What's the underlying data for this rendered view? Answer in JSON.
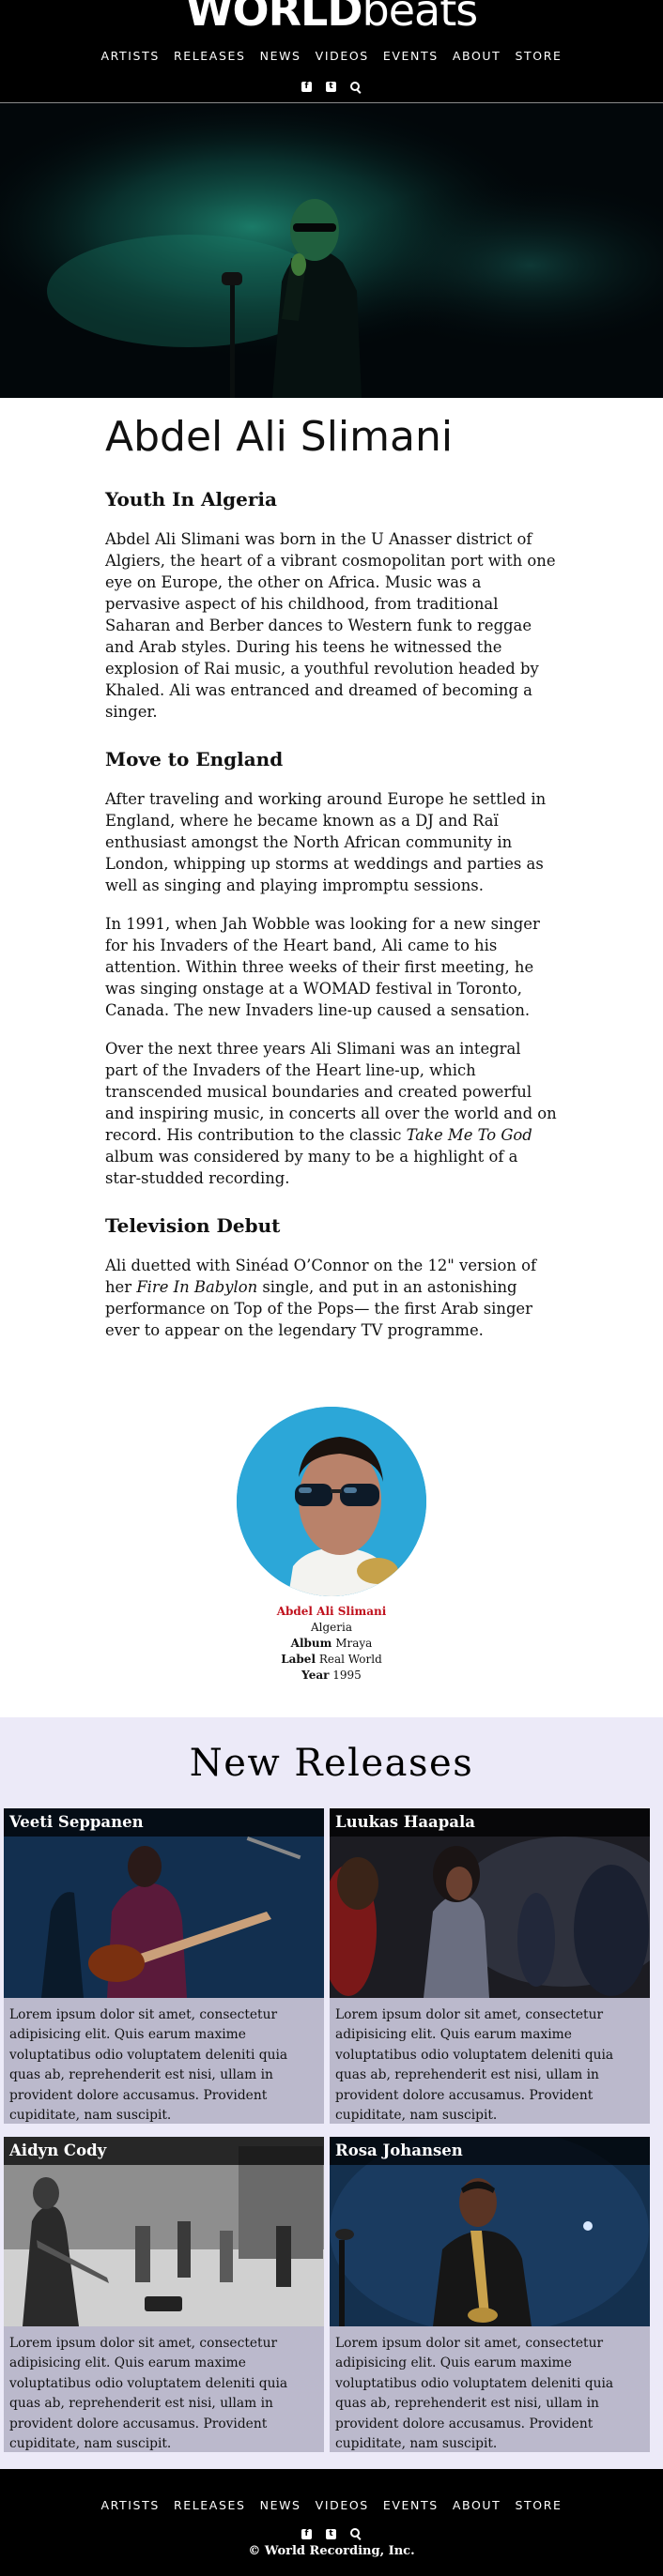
{
  "brand": {
    "bold": "WORLD",
    "light": "beats"
  },
  "nav": [
    "ARTISTS",
    "RELEASES",
    "NEWS",
    "VIDEOS",
    "EVENTS",
    "ABOUT",
    "STORE"
  ],
  "icons": [
    "facebook-icon",
    "twitter-icon",
    "search-icon"
  ],
  "artist": {
    "name": "Abdel Ali Slimani",
    "sections": [
      {
        "heading": "Youth In Algeria",
        "paragraphs": [
          [
            "Abdel Ali Slimani was born in the U Anasser district of Algiers, the heart of a vibrant cosmopolitan port with one eye on Europe, the other on Africa. Music was a pervasive aspect of his childhood, from traditional Saharan and Berber dances to Western funk to reggae and Arab styles. During his teens he witnessed the explosion of Rai music, a youthful revolution headed by Khaled. Ali was entranced and dreamed of becoming a singer.",
            "",
            ""
          ]
        ]
      },
      {
        "heading": "Move to England",
        "paragraphs": [
          [
            "After traveling and working around Europe he settled in England, where he became known as a DJ and Raï enthusiast amongst the North African community in London, whipping up storms at weddings and parties as well as singing and playing impromptu sessions.",
            "",
            ""
          ],
          [
            "In 1991, when Jah Wobble was looking for a new singer for his Invaders of the Heart band, Ali came to his attention. Within three weeks of their first meeting, he was singing onstage at a WOMAD festival in Toronto, Canada. The new Invaders line-up caused a sensation.",
            "",
            ""
          ],
          [
            "Over the next three years Ali Slimani was an integral part of the Invaders of the Heart line-up, which transcended musical boundaries and created powerful and inspiring music, in concerts all over the world and on record. His contribution to the classic ",
            "Take Me To God",
            " album was considered by many to be a highlight of a star-studded recording."
          ]
        ]
      },
      {
        "heading": "Television Debut",
        "paragraphs": [
          [
            "Ali duetted with Sinéad O’Connor on the 12\" version of her ",
            "Fire In Babylon",
            " single, and put in an astonishing performance on Top of the Pops— the first Arab singer ever to appear on the legendary TV programme."
          ]
        ]
      }
    ]
  },
  "profile": {
    "name": "Abdel Ali Slimani",
    "origin": "Algeria",
    "album_label": "Album",
    "album": "Mraya",
    "label_label": "Label",
    "label": "Real World",
    "year_label": "Year",
    "year": "1995"
  },
  "releases": {
    "title": "New Releases",
    "items": [
      {
        "name": "Veeti Seppanen",
        "text": "Lorem ipsum dolor sit amet, consectetur adipisicing elit. Quis earum maxime voluptatibus odio voluptatem deleniti quia quas ab, reprehenderit est nisi, ullam in provident dolore accusamus. Provident cupiditate, nam suscipit."
      },
      {
        "name": "Luukas Haapala",
        "text": "Lorem ipsum dolor sit amet, consectetur adipisicing elit. Quis earum maxime voluptatibus odio voluptatem deleniti quia quas ab, reprehenderit est nisi, ullam in provident dolore accusamus. Provident cupiditate, nam suscipit."
      },
      {
        "name": "Aidyn Cody",
        "text": "Lorem ipsum dolor sit amet, consectetur adipisicing elit. Quis earum maxime voluptatibus odio voluptatem deleniti quia quas ab, reprehenderit est nisi, ullam in provident dolore accusamus. Provident cupiditate, nam suscipit."
      },
      {
        "name": "Rosa Johansen",
        "text": "Lorem ipsum dolor sit amet, consectetur adipisicing elit. Quis earum maxime voluptatibus odio voluptatem deleniti quia quas ab, reprehenderit est nisi, ullam in provident dolore accusamus. Provident cupiditate, nam suscipit."
      }
    ]
  },
  "footer": {
    "copyright": "© World Recording, Inc."
  }
}
